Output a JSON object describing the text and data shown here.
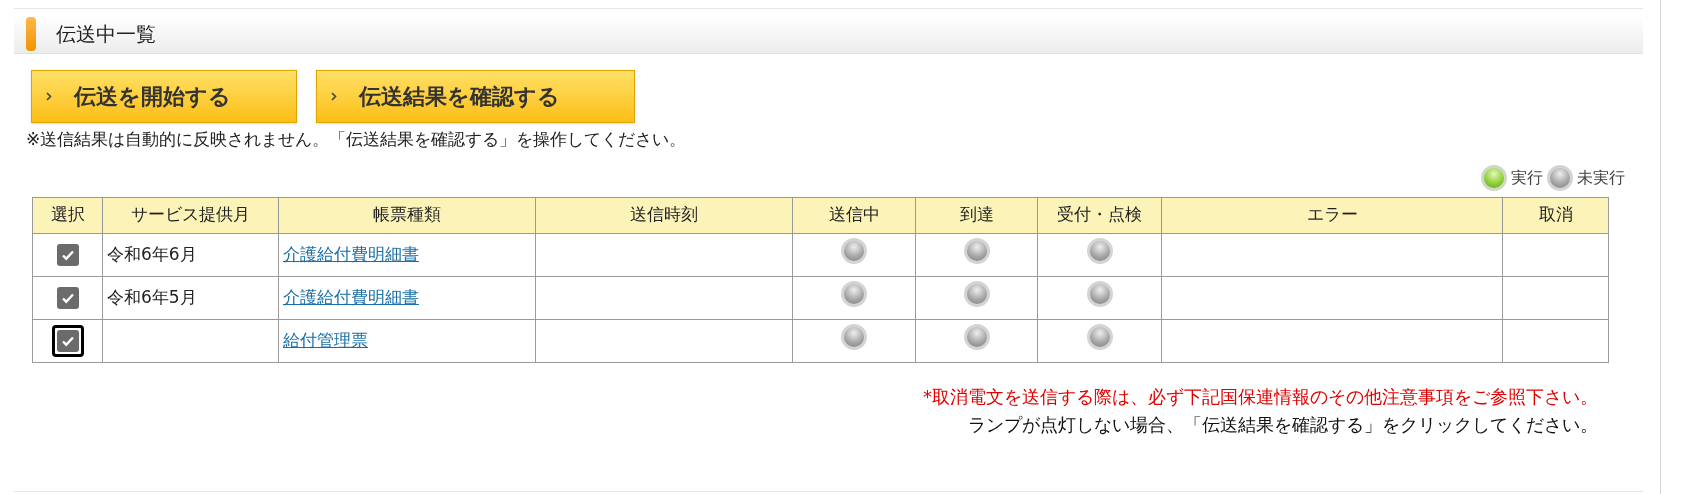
{
  "section": {
    "title": "伝送中一覧"
  },
  "buttons": [
    {
      "label": "伝送を開始する"
    },
    {
      "label": "伝送結果を確認する"
    }
  ],
  "note": "※送信結果は自動的に反映されません。「伝送結果を確認する」を操作してください。",
  "legend": [
    {
      "label": "実行",
      "on": true
    },
    {
      "label": "未実行",
      "on": false
    }
  ],
  "table": {
    "columns": [
      "選択",
      "サービス提供月",
      "帳票種類",
      "送信時刻",
      "送信中",
      "到達",
      "受付・点検",
      "エラー",
      "取消"
    ],
    "rows": [
      {
        "checked": true,
        "focused": false,
        "month": "令和6年6月",
        "form": "介護給付費明細書",
        "sending": false,
        "arrived": false,
        "accepted": false
      },
      {
        "checked": true,
        "focused": false,
        "month": "令和6年5月",
        "form": "介護給付費明細書",
        "sending": false,
        "arrived": false,
        "accepted": false
      },
      {
        "checked": true,
        "focused": true,
        "form": "給付管理票",
        "sending": false,
        "arrived": false,
        "accepted": false
      }
    ]
  },
  "warning": "*取消電文を送信する際は、必ず下記国保連情報のその他注意事項をご参照下さい。",
  "hint": "ランプが点灯しない場合、「伝送結果を確認する」をクリックしてください。"
}
